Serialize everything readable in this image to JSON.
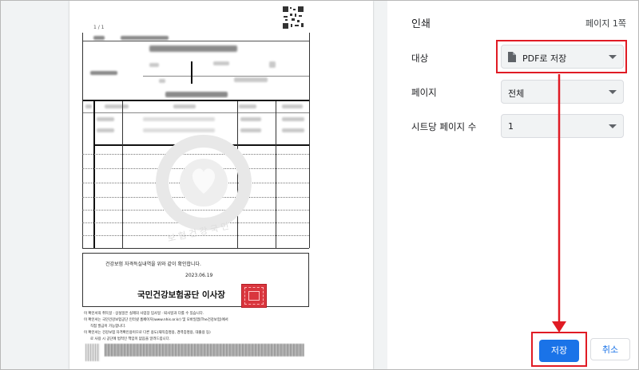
{
  "preview": {
    "page_indicator": "1 / 1",
    "notice_text": "건강보험 자격득실내역을 위와 같이 확인합니다.",
    "issue_date": "2023.06.19",
    "issuer": "국민건강보험공단 이사장",
    "watermark_text": "보 험 건 강 국 민",
    "footnotes": [
      "이 확인서의 취득일 · 상실일은 실제의 사업장 입사일 · 퇴사일과 다를 수 있습니다.",
      "이 확인서는 국민건강보험공단 인터넷 홈페이지(www.nhis.or.kr) 및 모바일앱(The건강보험)에서",
      "직접 발급이 가능합니다.",
      "이 확인서는 건강보험 자격확인용이므로 다른 용도(재직증명용, 경력증명용, 대출용 등)",
      "로 사용 시 공단에 법적인 책임이 없음을 알려드립니다."
    ]
  },
  "panel": {
    "title": "인쇄",
    "page_count": "페이지 1쪽",
    "destination": {
      "label": "대상",
      "value": "PDF로 저장"
    },
    "pages": {
      "label": "페이지",
      "value": "전체"
    },
    "pages_per_sheet": {
      "label": "시트당 페이지 수",
      "value": "1"
    },
    "save_button": "저장",
    "cancel_button": "취소"
  },
  "colors": {
    "accent": "#1a73e8",
    "annotation": "#e01b24",
    "panel_control_bg": "#f1f3f4"
  }
}
